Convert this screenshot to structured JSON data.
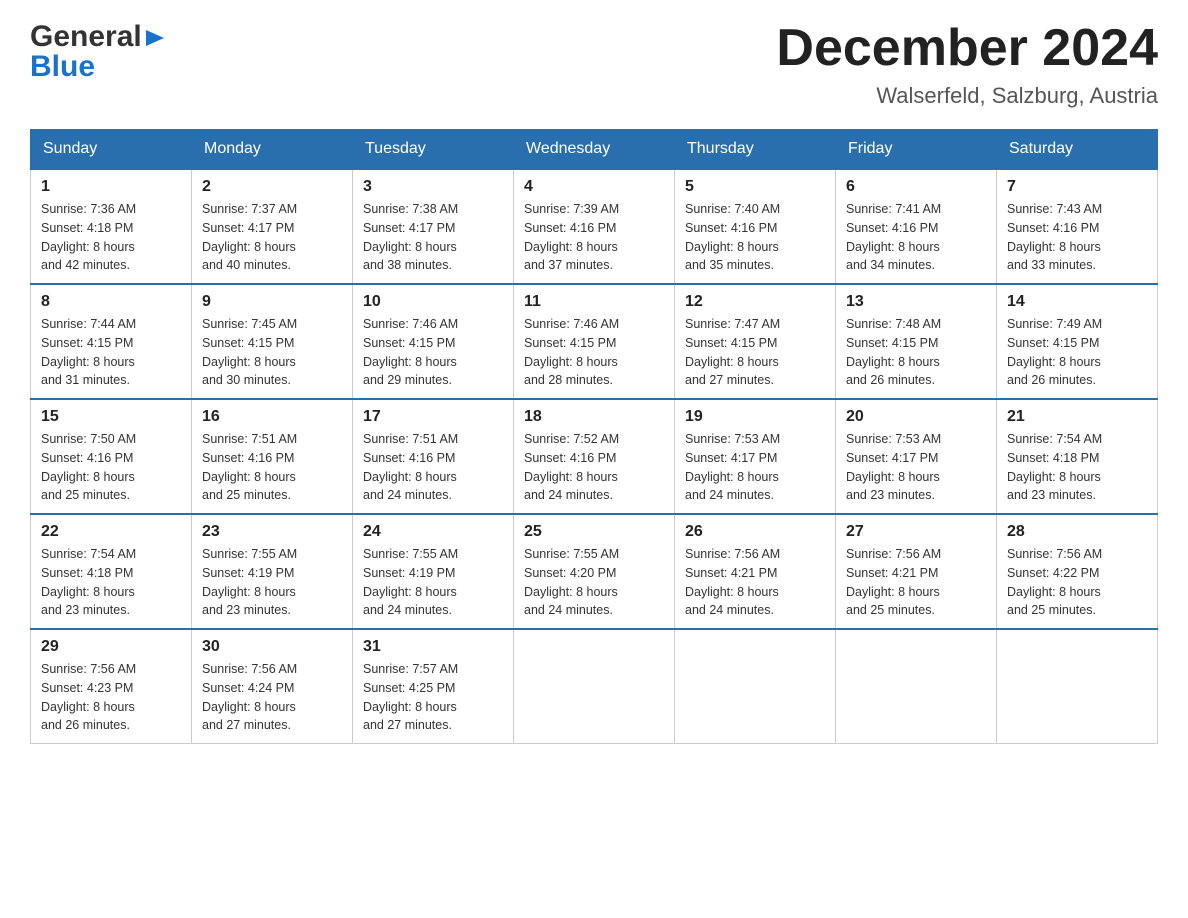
{
  "header": {
    "logo_general": "General",
    "logo_blue": "Blue",
    "month_title": "December 2024",
    "location": "Walserfeld, Salzburg, Austria"
  },
  "days_of_week": [
    "Sunday",
    "Monday",
    "Tuesday",
    "Wednesday",
    "Thursday",
    "Friday",
    "Saturday"
  ],
  "weeks": [
    [
      {
        "day": "1",
        "sunrise": "7:36 AM",
        "sunset": "4:18 PM",
        "daylight": "8 hours and 42 minutes."
      },
      {
        "day": "2",
        "sunrise": "7:37 AM",
        "sunset": "4:17 PM",
        "daylight": "8 hours and 40 minutes."
      },
      {
        "day": "3",
        "sunrise": "7:38 AM",
        "sunset": "4:17 PM",
        "daylight": "8 hours and 38 minutes."
      },
      {
        "day": "4",
        "sunrise": "7:39 AM",
        "sunset": "4:16 PM",
        "daylight": "8 hours and 37 minutes."
      },
      {
        "day": "5",
        "sunrise": "7:40 AM",
        "sunset": "4:16 PM",
        "daylight": "8 hours and 35 minutes."
      },
      {
        "day": "6",
        "sunrise": "7:41 AM",
        "sunset": "4:16 PM",
        "daylight": "8 hours and 34 minutes."
      },
      {
        "day": "7",
        "sunrise": "7:43 AM",
        "sunset": "4:16 PM",
        "daylight": "8 hours and 33 minutes."
      }
    ],
    [
      {
        "day": "8",
        "sunrise": "7:44 AM",
        "sunset": "4:15 PM",
        "daylight": "8 hours and 31 minutes."
      },
      {
        "day": "9",
        "sunrise": "7:45 AM",
        "sunset": "4:15 PM",
        "daylight": "8 hours and 30 minutes."
      },
      {
        "day": "10",
        "sunrise": "7:46 AM",
        "sunset": "4:15 PM",
        "daylight": "8 hours and 29 minutes."
      },
      {
        "day": "11",
        "sunrise": "7:46 AM",
        "sunset": "4:15 PM",
        "daylight": "8 hours and 28 minutes."
      },
      {
        "day": "12",
        "sunrise": "7:47 AM",
        "sunset": "4:15 PM",
        "daylight": "8 hours and 27 minutes."
      },
      {
        "day": "13",
        "sunrise": "7:48 AM",
        "sunset": "4:15 PM",
        "daylight": "8 hours and 26 minutes."
      },
      {
        "day": "14",
        "sunrise": "7:49 AM",
        "sunset": "4:15 PM",
        "daylight": "8 hours and 26 minutes."
      }
    ],
    [
      {
        "day": "15",
        "sunrise": "7:50 AM",
        "sunset": "4:16 PM",
        "daylight": "8 hours and 25 minutes."
      },
      {
        "day": "16",
        "sunrise": "7:51 AM",
        "sunset": "4:16 PM",
        "daylight": "8 hours and 25 minutes."
      },
      {
        "day": "17",
        "sunrise": "7:51 AM",
        "sunset": "4:16 PM",
        "daylight": "8 hours and 24 minutes."
      },
      {
        "day": "18",
        "sunrise": "7:52 AM",
        "sunset": "4:16 PM",
        "daylight": "8 hours and 24 minutes."
      },
      {
        "day": "19",
        "sunrise": "7:53 AM",
        "sunset": "4:17 PM",
        "daylight": "8 hours and 24 minutes."
      },
      {
        "day": "20",
        "sunrise": "7:53 AM",
        "sunset": "4:17 PM",
        "daylight": "8 hours and 23 minutes."
      },
      {
        "day": "21",
        "sunrise": "7:54 AM",
        "sunset": "4:18 PM",
        "daylight": "8 hours and 23 minutes."
      }
    ],
    [
      {
        "day": "22",
        "sunrise": "7:54 AM",
        "sunset": "4:18 PM",
        "daylight": "8 hours and 23 minutes."
      },
      {
        "day": "23",
        "sunrise": "7:55 AM",
        "sunset": "4:19 PM",
        "daylight": "8 hours and 23 minutes."
      },
      {
        "day": "24",
        "sunrise": "7:55 AM",
        "sunset": "4:19 PM",
        "daylight": "8 hours and 24 minutes."
      },
      {
        "day": "25",
        "sunrise": "7:55 AM",
        "sunset": "4:20 PM",
        "daylight": "8 hours and 24 minutes."
      },
      {
        "day": "26",
        "sunrise": "7:56 AM",
        "sunset": "4:21 PM",
        "daylight": "8 hours and 24 minutes."
      },
      {
        "day": "27",
        "sunrise": "7:56 AM",
        "sunset": "4:21 PM",
        "daylight": "8 hours and 25 minutes."
      },
      {
        "day": "28",
        "sunrise": "7:56 AM",
        "sunset": "4:22 PM",
        "daylight": "8 hours and 25 minutes."
      }
    ],
    [
      {
        "day": "29",
        "sunrise": "7:56 AM",
        "sunset": "4:23 PM",
        "daylight": "8 hours and 26 minutes."
      },
      {
        "day": "30",
        "sunrise": "7:56 AM",
        "sunset": "4:24 PM",
        "daylight": "8 hours and 27 minutes."
      },
      {
        "day": "31",
        "sunrise": "7:57 AM",
        "sunset": "4:25 PM",
        "daylight": "8 hours and 27 minutes."
      },
      null,
      null,
      null,
      null
    ]
  ],
  "labels": {
    "sunrise": "Sunrise:",
    "sunset": "Sunset:",
    "daylight": "Daylight:"
  }
}
